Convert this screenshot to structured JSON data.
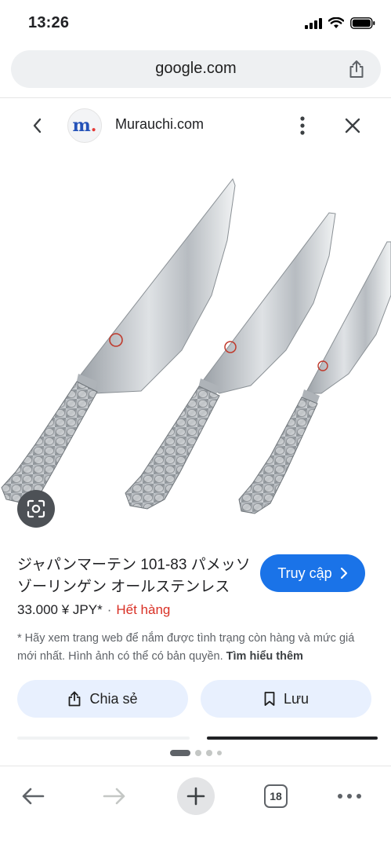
{
  "status_bar": {
    "time": "13:26"
  },
  "address_bar": {
    "url": "google.com"
  },
  "source": {
    "site_name": "Murauchi.com",
    "logo_letter": "m",
    "logo_dot": "."
  },
  "product": {
    "title": "ジャパンマーテン 101-83 パメッソ ゾーリンゲン オールステンレス",
    "visit_label": "Truy cập",
    "price": "33.000 ¥ JPY*",
    "separator": "·",
    "stock_status": "Hết hàng",
    "disclaimer": "* Hãy xem trang web để nắm được tình trạng còn hàng và mức giá mới nhất. Hình ảnh có thể có bản quyền.",
    "learn_more": "Tìm hiểu thêm"
  },
  "actions": {
    "share_label": "Chia sẻ",
    "save_label": "Lưu"
  },
  "toolbar": {
    "tab_count": "18"
  },
  "icons": {
    "signal": "signal-icon",
    "wifi": "wifi-icon",
    "battery": "battery-icon",
    "share": "share-icon",
    "back": "chevron-left-icon",
    "more": "more-vert-icon",
    "close": "close-icon",
    "lens": "lens-icon",
    "visit": "chevron-right-icon",
    "bookmark": "bookmark-icon",
    "nav_back": "arrow-left-icon",
    "nav_forward": "arrow-right-icon",
    "new_tab": "plus-icon",
    "menu": "more-horiz-icon"
  },
  "colors": {
    "primary": "#1a73e8",
    "out_of_stock": "#d93025",
    "button_tint": "#e8f0fe"
  }
}
